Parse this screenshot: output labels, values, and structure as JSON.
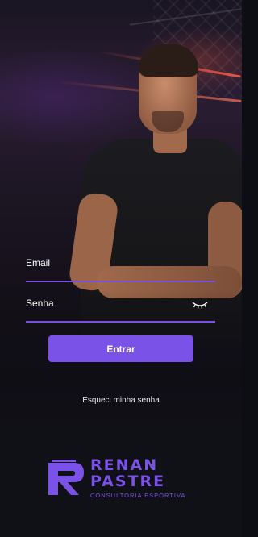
{
  "form": {
    "email_label": "Email",
    "password_label": "Senha",
    "login_button": "Entrar",
    "forgot_password": "Esqueci minha senha"
  },
  "logo": {
    "name_line1": "RENAN",
    "name_line2": "PASTRE",
    "tagline": "CONSULTORIA ESPORTIVA"
  },
  "colors": {
    "accent": "#7b52e8",
    "background": "#0f0e15",
    "text": "#ffffff"
  },
  "icons": {
    "password_toggle": "eye-closed-icon",
    "logo_mark": "rp-monogram-icon"
  }
}
